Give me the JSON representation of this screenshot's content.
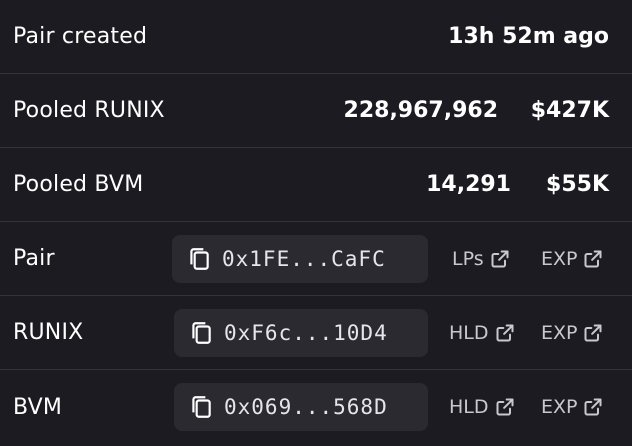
{
  "rows": {
    "pair_created": {
      "label": "Pair created",
      "value": "13h 52m ago"
    },
    "pooled_runix": {
      "label": "Pooled RUNIX",
      "amount": "228,967,962",
      "usd": "$427K"
    },
    "pooled_bvm": {
      "label": "Pooled BVM",
      "amount": "14,291",
      "usd": "$55K"
    },
    "pair": {
      "label": "Pair",
      "address": "0x1FE...CaFC",
      "link1": "LPs",
      "link2": "EXP"
    },
    "runix": {
      "label": "RUNIX",
      "address": "0xF6c...10D4",
      "link1": "HLD",
      "link2": "EXP"
    },
    "bvm": {
      "label": "BVM",
      "address": "0x069...568D",
      "link1": "HLD",
      "link2": "EXP"
    }
  },
  "icons": {
    "copy": "copy-icon",
    "external": "external-link-icon"
  },
  "colors": {
    "background": "#1c1b21",
    "pill": "#2b2a31",
    "divider": "#34333b",
    "text": "#ffffff",
    "muted": "#c8c8ce"
  }
}
